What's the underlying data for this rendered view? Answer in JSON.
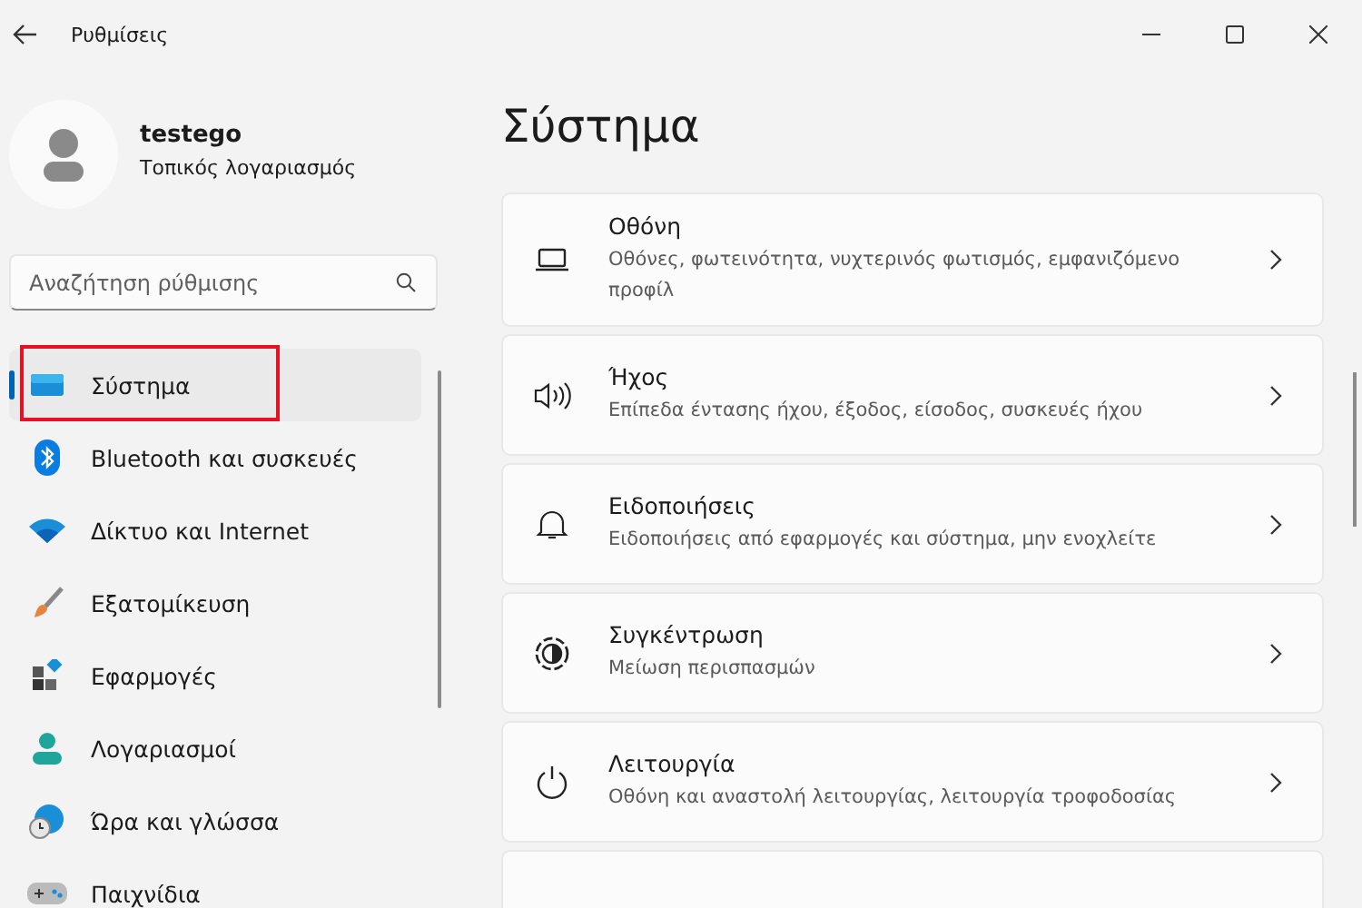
{
  "window": {
    "title": "Ρυθμίσεις"
  },
  "user": {
    "name": "testego",
    "account": "Τοπικός λογαριασμός"
  },
  "search": {
    "placeholder": "Αναζήτηση ρύθμισης"
  },
  "nav": [
    {
      "label": "Σύστημα",
      "kind": "system",
      "selected": true,
      "highlighted": true
    },
    {
      "label": "Bluetooth και συσκευές",
      "kind": "bluetooth",
      "selected": false,
      "highlighted": false
    },
    {
      "label": "Δίκτυο και Internet",
      "kind": "network",
      "selected": false,
      "highlighted": false
    },
    {
      "label": "Εξατομίκευση",
      "kind": "brush",
      "selected": false,
      "highlighted": false
    },
    {
      "label": "Εφαρμογές",
      "kind": "apps",
      "selected": false,
      "highlighted": false
    },
    {
      "label": "Λογαριασμοί",
      "kind": "person",
      "selected": false,
      "highlighted": false
    },
    {
      "label": "Ώρα και γλώσσα",
      "kind": "globe",
      "selected": false,
      "highlighted": false
    },
    {
      "label": "Παιχνίδια",
      "kind": "gamepad",
      "selected": false,
      "highlighted": false
    }
  ],
  "page_title": "Σύστημα",
  "cards": [
    {
      "title": "Οθόνη",
      "description": "Οθόνες, φωτεινότητα, νυχτερινός φωτισμός, εμφανιζόμενο προφίλ",
      "kind": "display"
    },
    {
      "title": "Ήχος",
      "description": "Επίπεδα έντασης ήχου, έξοδος, είσοδος, συσκευές ήχου",
      "kind": "sound"
    },
    {
      "title": "Ειδοποιήσεις",
      "description": "Ειδοποιήσεις από εφαρμογές και σύστημα, μην ενοχλείτε",
      "kind": "bell"
    },
    {
      "title": "Συγκέντρωση",
      "description": "Μείωση περισπασμών",
      "kind": "focus"
    },
    {
      "title": "Λειτουργία",
      "description": "Οθόνη και αναστολή λειτουργίας, λειτουργία τροφοδοσίας",
      "kind": "power"
    }
  ]
}
